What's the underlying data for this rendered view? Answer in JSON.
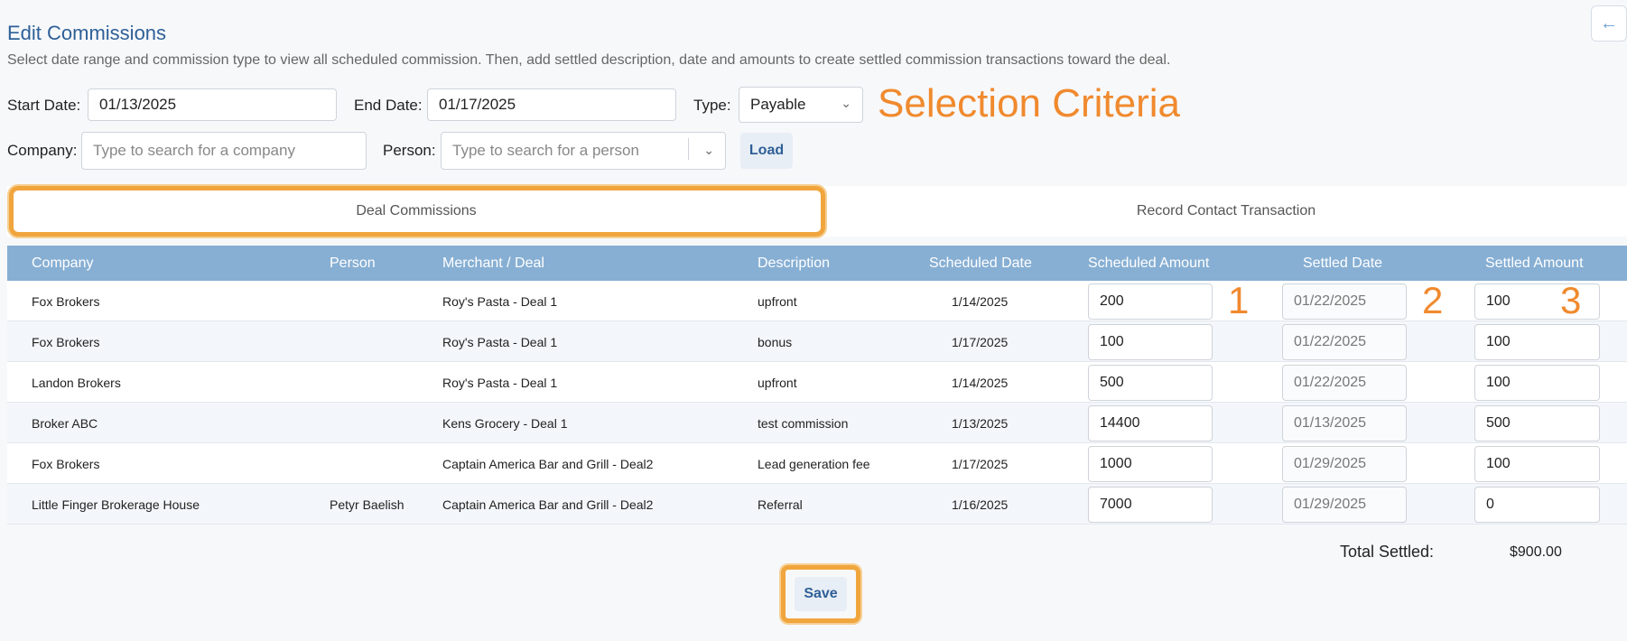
{
  "page": {
    "title": "Edit Commissions",
    "subtitle": "Select date range and commission type to view all scheduled commission. Then, add settled description, date and amounts to create settled commission transactions toward the deal.",
    "back_icon": "arrow-left-icon"
  },
  "filters": {
    "start_label": "Start Date:",
    "start_value": "01/13/2025",
    "end_label": "End Date:",
    "end_value": "01/17/2025",
    "type_label": "Type:",
    "type_value": "Payable",
    "company_label": "Company:",
    "company_placeholder": "Type to search for a company",
    "person_label": "Person:",
    "person_placeholder": "Type to search for a person",
    "load_label": "Load"
  },
  "annotations": {
    "selection_criteria": "Selection Criteria",
    "n1": "1",
    "n2": "2",
    "n3": "3",
    "color": "#f08a2e"
  },
  "tabs": [
    {
      "label": "Deal Commissions",
      "active": true
    },
    {
      "label": "Record Contact Transaction",
      "active": false
    }
  ],
  "table": {
    "headers": [
      "Company",
      "Person",
      "Merchant / Deal",
      "Description",
      "Scheduled Date",
      "Scheduled Amount",
      "Settled Date",
      "Settled Amount"
    ],
    "rows": [
      {
        "company": "Fox Brokers",
        "person": "",
        "deal": "Roy's Pasta - Deal 1",
        "description": "upfront",
        "scheduled_date": "1/14/2025",
        "scheduled_amount": "200",
        "settled_date": "01/22/2025",
        "settled_amount": "100"
      },
      {
        "company": "Fox Brokers",
        "person": "",
        "deal": "Roy's Pasta - Deal 1",
        "description": "bonus",
        "scheduled_date": "1/17/2025",
        "scheduled_amount": "100",
        "settled_date": "01/22/2025",
        "settled_amount": "100"
      },
      {
        "company": "Landon Brokers",
        "person": "",
        "deal": "Roy's Pasta - Deal 1",
        "description": "upfront",
        "scheduled_date": "1/14/2025",
        "scheduled_amount": "500",
        "settled_date": "01/22/2025",
        "settled_amount": "100"
      },
      {
        "company": "Broker ABC",
        "person": "",
        "deal": "Kens Grocery - Deal 1",
        "description": "test commission",
        "scheduled_date": "1/13/2025",
        "scheduled_amount": "14400",
        "settled_date": "01/13/2025",
        "settled_amount": "500"
      },
      {
        "company": "Fox Brokers",
        "person": "",
        "deal": "Captain America Bar and Grill - Deal2",
        "description": "Lead generation fee",
        "scheduled_date": "1/17/2025",
        "scheduled_amount": "1000",
        "settled_date": "01/29/2025",
        "settled_amount": "100"
      },
      {
        "company": "Little Finger Brokerage House",
        "person": "Petyr Baelish",
        "deal": "Captain America Bar and Grill - Deal2",
        "description": "Referral",
        "scheduled_date": "1/16/2025",
        "scheduled_amount": "7000",
        "settled_date": "01/29/2025",
        "settled_amount": "0"
      }
    ]
  },
  "totals": {
    "label": "Total Settled:",
    "value": "$900.00"
  },
  "actions": {
    "save_label": "Save"
  },
  "colors": {
    "header_bg": "#87afd3",
    "title": "#2e5f98",
    "highlight": "#f0a53d"
  }
}
